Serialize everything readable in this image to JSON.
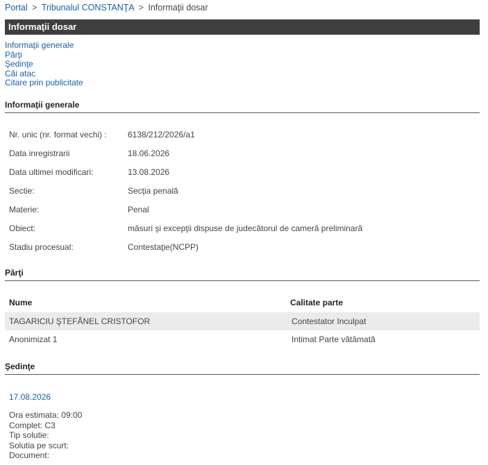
{
  "breadcrumb": {
    "portal": "Portal",
    "court": "Tribunalul CONSTANŢA",
    "current": "Informaţii dosar",
    "sep": ">"
  },
  "header": {
    "title": "Informaţii dosar"
  },
  "toc": [
    "Informaţii generale",
    "Părţi",
    "Şedinţe",
    "Căi atac",
    "Citare prin publicitate"
  ],
  "general": {
    "heading": "Informaţii generale",
    "rows": [
      {
        "label": "Nr. unic (nr. format vechi) :",
        "value": "6138/212/2026/a1"
      },
      {
        "label": "Data inregistrarii",
        "value": "18.06.2026"
      },
      {
        "label": "Data ultimei modificari:",
        "value": "13.08.2026"
      },
      {
        "label": "Sectie:",
        "value": "Secţia penală"
      },
      {
        "label": "Materie:",
        "value": "Penal"
      },
      {
        "label": "Obiect:",
        "value": "măsuri şi excepţii dispuse de judecătorul de cameră preliminară"
      },
      {
        "label": "Stadiu procesual:",
        "value": "Contestaţie(NCPP)"
      }
    ]
  },
  "parties": {
    "heading": "Părţi",
    "col_name": "Nume",
    "col_role": "Calitate parte",
    "rows": [
      {
        "name": "TAGARICIU ŞTEFĂNEL CRISTOFOR",
        "role": "Contestator Inculpat"
      },
      {
        "name": "Anonimizat 1",
        "role": "Intimat Parte vătămată"
      }
    ]
  },
  "hearings": {
    "heading": "Şedinţe",
    "date": "17.08.2026",
    "lines": [
      "Ora estimata: 09:00",
      "Complet: C3",
      "Tip solutie:",
      "Solutia pe scurt:",
      "Document:"
    ]
  }
}
